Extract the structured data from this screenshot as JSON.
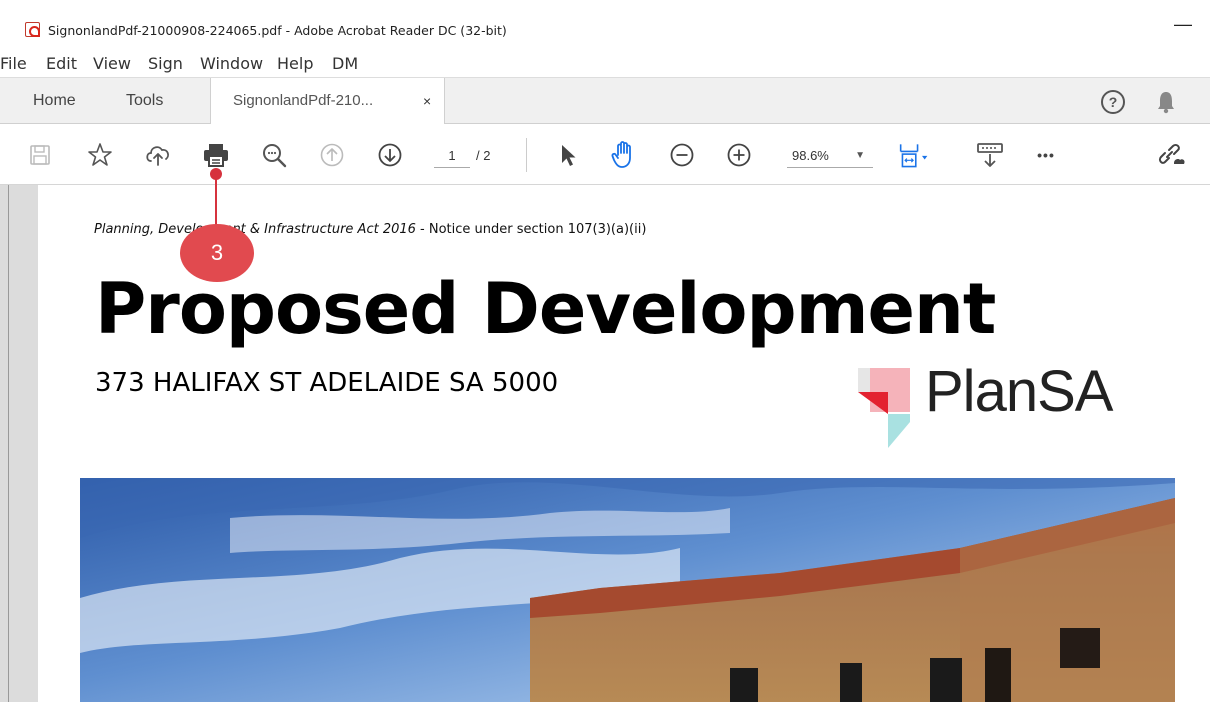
{
  "window": {
    "title": "SignonlandPdf-21000908-224065.pdf - Adobe Acrobat Reader DC (32-bit)",
    "minimize_glyph": "—"
  },
  "menu": [
    "File",
    "Edit",
    "View",
    "Sign",
    "Window",
    "Help",
    "DM"
  ],
  "tabs": {
    "home": "Home",
    "tools": "Tools",
    "document": "SignonlandPdf-210...",
    "close_glyph": "×"
  },
  "toolbar": {
    "page_current": "1",
    "page_total": "/ 2",
    "zoom": "98.6%",
    "zoom_caret": "▼",
    "more_glyph": "•••"
  },
  "help_glyph": "?",
  "document": {
    "act_italic": "Planning, Development & Infrastructure Act 2016",
    "act_rest": " - Notice under section 107(3)(a)(ii)",
    "heading": "Proposed Development",
    "address": "373 HALIFAX ST ADELAIDE SA 5000",
    "logo_text": "PlanSA"
  },
  "annotation": {
    "step": "3"
  },
  "colors": {
    "accent_red": "#d6323d",
    "badge_red": "#e14a4f",
    "link_blue": "#1a73e8"
  }
}
